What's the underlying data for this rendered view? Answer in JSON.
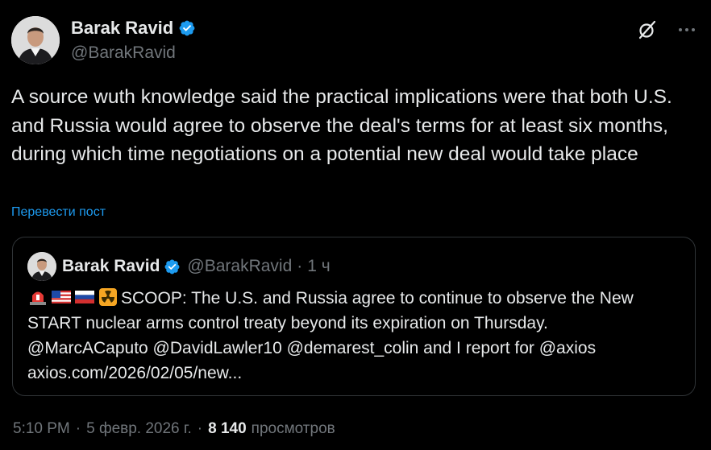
{
  "author": {
    "name": "Barak Ravid",
    "handle": "@BarakRavid"
  },
  "tweet": {
    "text": "A source wuth knowledge said the practical implications were that both U.S. and Russia would agree to observe the deal's terms for at least six months, during which time negotiations on a potential new deal would take place",
    "translate_label": "Перевести пост"
  },
  "quote": {
    "name": "Barak Ravid",
    "handle": "@BarakRavid",
    "separator": "·",
    "time": "1 ч",
    "emojis": [
      "rotating-light-emoji",
      "us-flag-emoji",
      "russia-flag-emoji",
      "radioactive-emoji"
    ],
    "text_line1": "SCOOP: The U.S. and Russia agree to continue to observe the New",
    "text_line2": "START nuclear arms control treaty beyond its expiration on Thursday.",
    "text_line3": "@MarcACaputo @DavidLawler10 @demarest_colin and I report for @axios",
    "link": "axios.com/2026/02/05/new..."
  },
  "footer": {
    "time": "5:10 PM",
    "separator": "·",
    "date": "5 февр. 2026 г.",
    "views_count": "8 140",
    "views_label": "просмотров"
  },
  "colors": {
    "background": "#000000",
    "text": "#e7e9ea",
    "secondary": "#71767b",
    "link": "#1d9bf0",
    "border": "#2f3336"
  }
}
